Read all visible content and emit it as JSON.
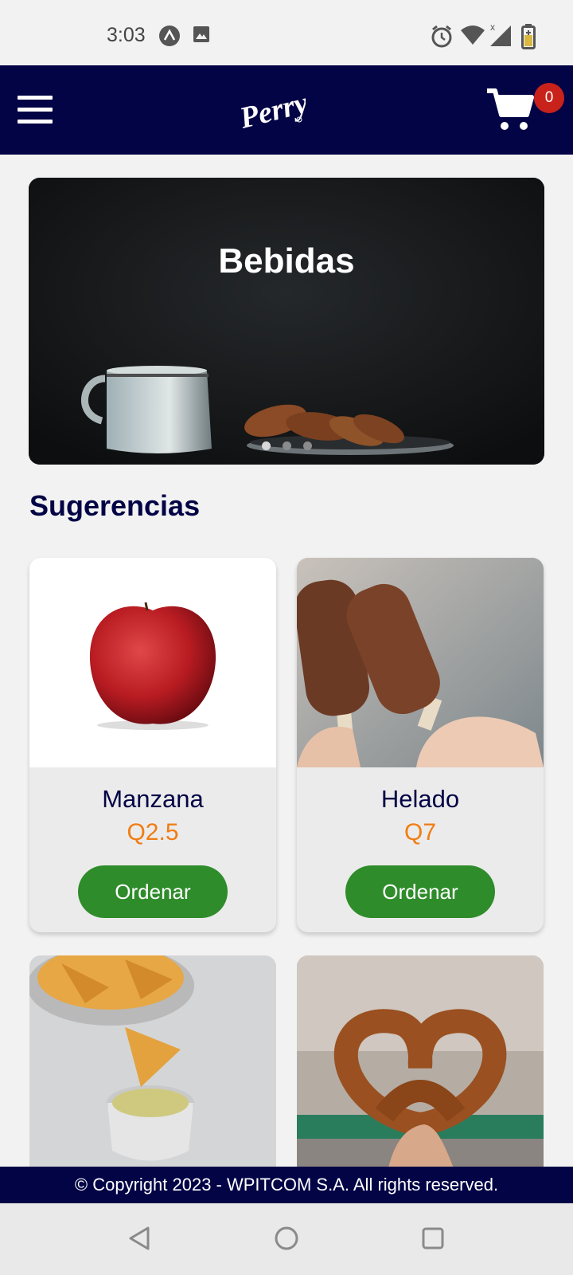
{
  "status_bar": {
    "time": "3:03"
  },
  "header": {
    "logo_text": "Perry",
    "cart_count": "0"
  },
  "carousel": {
    "title": "Bebidas",
    "slide_count": 3,
    "active_index": 0
  },
  "section": {
    "title": "Sugerencias"
  },
  "products": [
    {
      "name": "Manzana",
      "price": "Q2.5",
      "button": "Ordenar"
    },
    {
      "name": "Helado",
      "price": "Q7",
      "button": "Ordenar"
    }
  ],
  "footer": {
    "text": "© Copyright 2023 - WPITCOM S.A. All rights reserved."
  },
  "colors": {
    "navy": "#030446",
    "accent_green": "#2e8c2a",
    "price_orange": "#f07d12",
    "badge_red": "#c8221b"
  }
}
